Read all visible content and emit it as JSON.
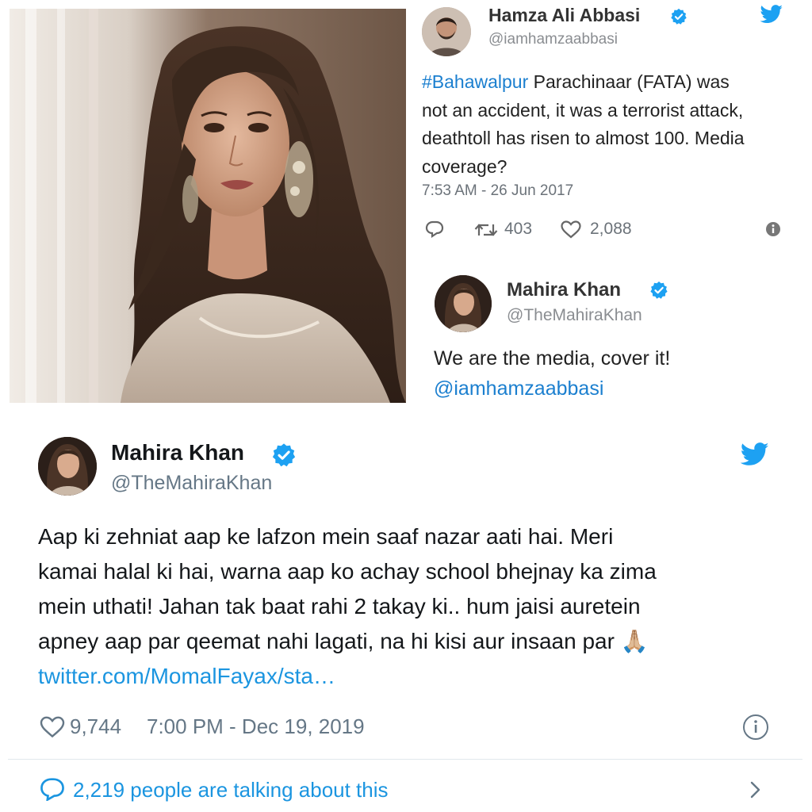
{
  "top_tweet": {
    "author_name": "Hamza Ali Abbasi",
    "author_handle": "@iamhamzaabbasi",
    "hashtag": "#Bahawalpur",
    "body_lines": [
      " Parachinaar (FATA) was",
      "not an accident, it was a terrorist attack,",
      "deathtoll has risen to almost 100. Media",
      "coverage?"
    ],
    "timestamp": "7:53 AM - 26 Jun 2017",
    "retweets": "403",
    "likes": "2,088",
    "reply": {
      "author_name": "Mahira Khan",
      "author_handle": "@TheMahiraKhan",
      "text": "We are the media, cover it!",
      "mention": "@iamhamzaabbasi"
    }
  },
  "bottom_tweet": {
    "author_name": "Mahira Khan",
    "author_handle": "@TheMahiraKhan",
    "body_lines": [
      "Aap ki zehniat aap ke lafzon mein saaf nazar aati hai. Meri",
      "kamai halal ki hai, warna aap ko achay school bhejnay ka zima",
      "mein uthati! Jahan tak baat rahi 2 takay ki.. hum jaisi auretein",
      "apney aap par qeemat nahi lagati, na hi kisi aur insaan par"
    ],
    "emoji": "🙏🏼",
    "link": "twitter.com/MomalFayax/sta…",
    "likes": "9,744",
    "timestamp": "7:00 PM - Dec 19, 2019",
    "talking": "2,219 people are talking about this"
  },
  "colors": {
    "twitter_blue": "#1da1f2",
    "link_blue": "#1b7fcf",
    "verified_blue": "#1da1f2",
    "text_dark": "#14171a",
    "muted": "#657786"
  },
  "icons": [
    "verified-badge-icon",
    "twitter-bird-icon",
    "reply-icon",
    "retweet-icon",
    "heart-icon",
    "info-icon",
    "speech-bubble-icon",
    "chevron-right-icon"
  ]
}
